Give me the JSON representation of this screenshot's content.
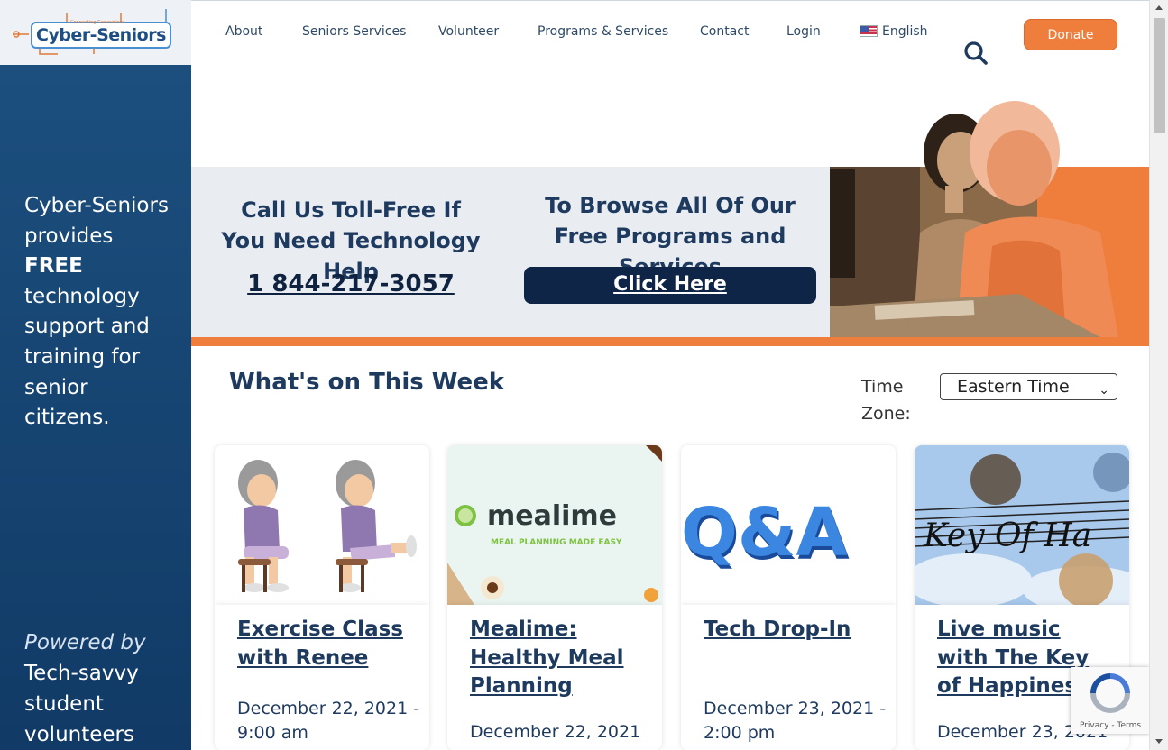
{
  "brand": {
    "logo_text": "Cyber-Seniors",
    "logo_tagline": "Connecting Generations"
  },
  "nav": {
    "items": [
      "About",
      "Seniors Services",
      "Volunteer",
      "Programs & Services",
      "Contact",
      "Login"
    ],
    "language": "English",
    "donate": "Donate"
  },
  "sidebar": {
    "text_pre": "Cyber-Seniors provides ",
    "text_bold": "FREE",
    "text_post": " technology support and training for senior citizens.",
    "powered_by": "Powered by",
    "powered_rest": "Tech-savvy student volunteers"
  },
  "hero": {
    "call_title": "Call Us Toll-Free If You Need Technology Help",
    "phone": "1 844-217-3057",
    "browse_title": "To Browse All Of Our Free Programs and Services",
    "click_here": "Click Here"
  },
  "week": {
    "title": "What's on This Week",
    "tz_label": "Time Zone:",
    "tz_value": "Eastern Time"
  },
  "cards": [
    {
      "title": "Exercise Class with Renee",
      "date": "December 22, 2021 - 9:00 am",
      "image": "seniors-exercise-illustration"
    },
    {
      "title": "Mealime: Healthy Meal Planning",
      "date": "December 22, 2021",
      "image": "mealime-logo",
      "image_word": "mealime",
      "image_tag": "MEAL PLANNING MADE EASY"
    },
    {
      "title": "Tech Drop-In",
      "date": "December 23, 2021 - 2:00 pm",
      "image": "qa-3d-text",
      "image_word": "Q&A"
    },
    {
      "title": "Live music with The Key of Happiness",
      "date": "December 23, 2021",
      "image": "key-of-happiness-collage",
      "image_word": "Key Of Ha"
    }
  ],
  "recaptcha": {
    "privacy": "Privacy",
    "terms": "Terms"
  },
  "colors": {
    "navy": "#1e3a5f",
    "orange": "#ef7d3c",
    "sidebar": "#1c4f7e",
    "button_dark": "#0f2547"
  }
}
